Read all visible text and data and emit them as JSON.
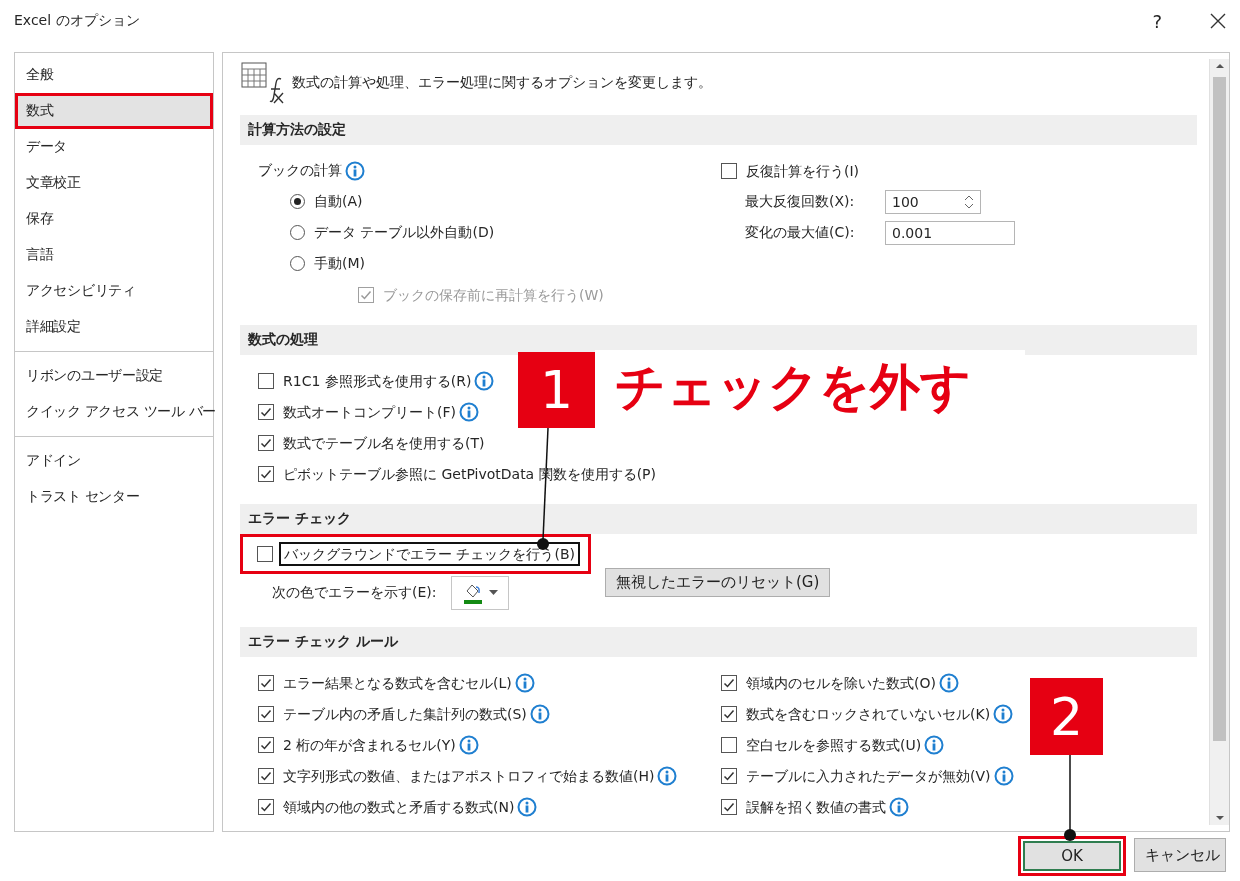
{
  "window": {
    "title": "Excel のオプション",
    "help": "?"
  },
  "sidebar": {
    "groups": [
      [
        {
          "label": "全般",
          "selected": false,
          "highlighted": false
        },
        {
          "label": "数式",
          "selected": true,
          "highlighted": true
        },
        {
          "label": "データ",
          "selected": false,
          "highlighted": false
        },
        {
          "label": "文章校正",
          "selected": false,
          "highlighted": false
        },
        {
          "label": "保存",
          "selected": false,
          "highlighted": false
        },
        {
          "label": "言語",
          "selected": false,
          "highlighted": false
        },
        {
          "label": "アクセシビリティ",
          "selected": false,
          "highlighted": false
        },
        {
          "label": "詳細設定",
          "selected": false,
          "highlighted": false
        }
      ],
      [
        {
          "label": "リボンのユーザー設定",
          "selected": false,
          "highlighted": false
        },
        {
          "label": "クイック アクセス ツール バー",
          "selected": false,
          "highlighted": false
        }
      ],
      [
        {
          "label": "アドイン",
          "selected": false,
          "highlighted": false
        },
        {
          "label": "トラスト センター",
          "selected": false,
          "highlighted": false
        }
      ]
    ]
  },
  "header": {
    "text": "数式の計算や処理、エラー処理に関するオプションを変更します。"
  },
  "calculation": {
    "title": "計算方法の設定",
    "workbook_label": "ブックの計算",
    "modes": [
      {
        "label": "自動(A)",
        "selected": true
      },
      {
        "label": "データ テーブル以外自動(D)",
        "selected": false
      },
      {
        "label": "手動(M)",
        "selected": false
      }
    ],
    "recalc_before_save": {
      "label": "ブックの保存前に再計算を行う(W)",
      "checked": true,
      "disabled": true
    },
    "iterative": {
      "label": "反復計算を行う(I)",
      "checked": false,
      "disabled": false
    },
    "max_iterations": {
      "label": "最大反復回数(X):",
      "value": "100"
    },
    "max_change": {
      "label": "変化の最大値(C):",
      "value": "0.001"
    }
  },
  "formulas": {
    "title": "数式の処理",
    "options": [
      {
        "label": "R1C1 参照形式を使用する(R)",
        "checked": false,
        "info": true
      },
      {
        "label": "数式オートコンプリート(F)",
        "checked": true,
        "info": true
      },
      {
        "label": "数式でテーブル名を使用する(T)",
        "checked": true,
        "info": false
      },
      {
        "label": "ピボットテーブル参照に GetPivotData 関数を使用する(P)",
        "checked": true,
        "info": false
      }
    ]
  },
  "error_check": {
    "title": "エラー チェック",
    "background": {
      "label": "バックグラウンドでエラー チェックを行う(B)",
      "checked": false,
      "highlighted": true
    },
    "color_label": "次の色でエラーを示す(E):",
    "reset_button": "無視したエラーのリセット(G)"
  },
  "error_rules": {
    "title": "エラー チェック ルール",
    "left": [
      {
        "label": "エラー結果となる数式を含むセル(L)",
        "checked": true,
        "info": true
      },
      {
        "label": "テーブル内の矛盾した集計列の数式(S)",
        "checked": true,
        "info": true
      },
      {
        "label": "2 桁の年が含まれるセル(Y)",
        "checked": true,
        "info": true
      },
      {
        "label": "文字列形式の数値、またはアポストロフィで始まる数値(H)",
        "checked": true,
        "info": true
      },
      {
        "label": "領域内の他の数式と矛盾する数式(N)",
        "checked": true,
        "info": true
      }
    ],
    "right": [
      {
        "label": "領域内のセルを除いた数式(O)",
        "checked": true,
        "info": true
      },
      {
        "label": "数式を含むロックされていないセル(K)",
        "checked": true,
        "info": true
      },
      {
        "label": "空白セルを参照する数式(U)",
        "checked": false,
        "info": true
      },
      {
        "label": "テーブルに入力されたデータが無効(V)",
        "checked": true,
        "info": true
      },
      {
        "label": "誤解を招く数値の書式",
        "checked": true,
        "info": true
      }
    ]
  },
  "buttons": [
    {
      "label": "OK",
      "default": true,
      "highlighted": true
    },
    {
      "label": "キャンセル",
      "default": false,
      "highlighted": false
    }
  ],
  "annotations": {
    "step1": {
      "number": "1",
      "caption": "チェックを外す"
    },
    "step2": {
      "number": "2"
    }
  }
}
